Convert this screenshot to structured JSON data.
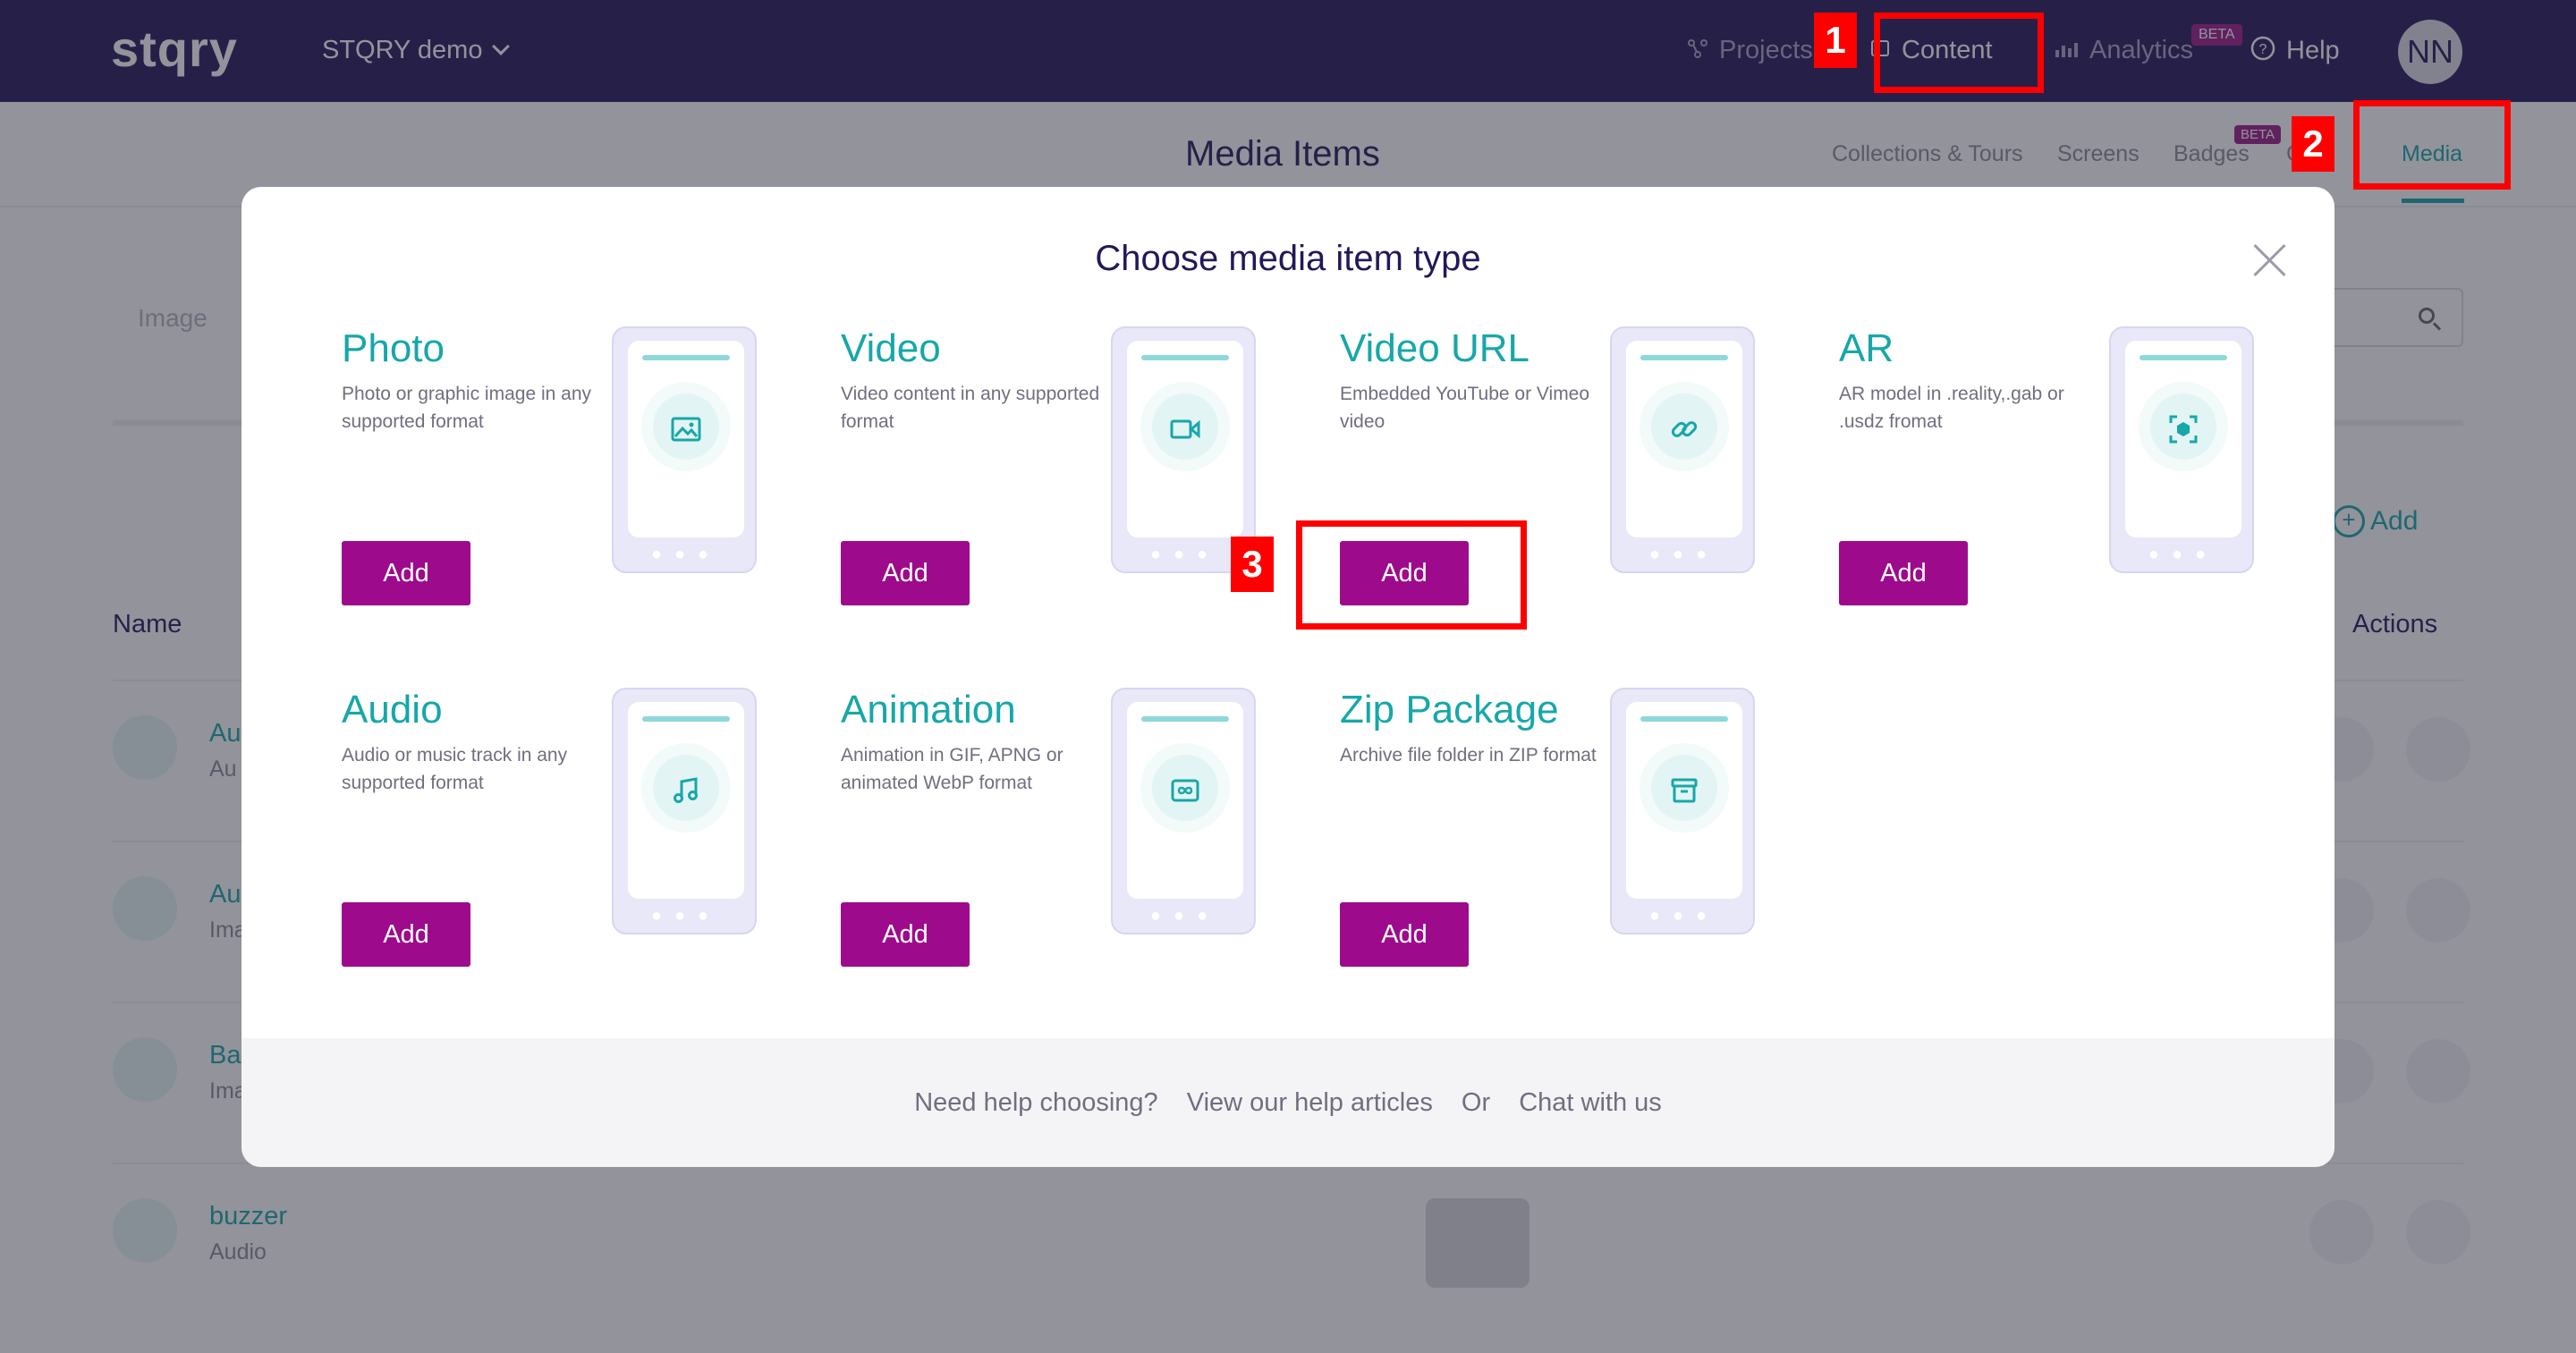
{
  "topbar": {
    "logo": "stqry",
    "project": "STQRY demo",
    "nav": {
      "projects": "Projects",
      "content": "Content",
      "analytics": "Analytics",
      "analytics_badge": "BETA",
      "help": "Help"
    },
    "avatar": "NN"
  },
  "subbar": {
    "title": "Media Items",
    "tabs": {
      "collections": "Collections & Tours",
      "screens": "Screens",
      "badges": "Badges",
      "badges_badge": "BETA",
      "other": "C",
      "media": "Media"
    }
  },
  "background": {
    "filter": "Image",
    "add": "Add",
    "columns": {
      "name": "Name",
      "actions": "Actions"
    },
    "rows": [
      {
        "title": "Au",
        "subtitle": "Au"
      },
      {
        "title": "Au",
        "subtitle": "Ima"
      },
      {
        "title": "Bac",
        "subtitle": "Ima"
      },
      {
        "title": "buzzer",
        "subtitle": "Audio"
      }
    ]
  },
  "modal": {
    "title": "Choose media item type",
    "types": [
      {
        "title": "Photo",
        "desc": "Photo or graphic image in any supported format",
        "button": "Add",
        "icon": "image-icon"
      },
      {
        "title": "Video",
        "desc": "Video content in any supported format",
        "button": "Add",
        "icon": "video-camera-icon"
      },
      {
        "title": "Video URL",
        "desc": "Embedded YouTube or Vimeo video",
        "button": "Add",
        "icon": "link-icon"
      },
      {
        "title": "AR",
        "desc": "AR model in .reality,.gab or .usdz fromat",
        "button": "Add",
        "icon": "ar-cube-icon"
      },
      {
        "title": "Audio",
        "desc": "Audio or music track in any supported format",
        "button": "Add",
        "icon": "music-note-icon"
      },
      {
        "title": "Animation",
        "desc": "Animation in GIF, APNG or animated WebP format",
        "button": "Add",
        "icon": "infinity-icon"
      },
      {
        "title": "Zip Package",
        "desc": "Archive file folder in ZIP format",
        "button": "Add",
        "icon": "archive-box-icon"
      }
    ],
    "footer": {
      "question": "Need help choosing?",
      "articles": "View our help articles",
      "or": "Or",
      "chat": "Chat with us"
    }
  },
  "annotations": [
    "1",
    "2",
    "3"
  ],
  "colors": {
    "topbar": "#24185a",
    "accent": "#17a7a9",
    "button": "#9e0a8c",
    "highlight": "#ff0000"
  }
}
